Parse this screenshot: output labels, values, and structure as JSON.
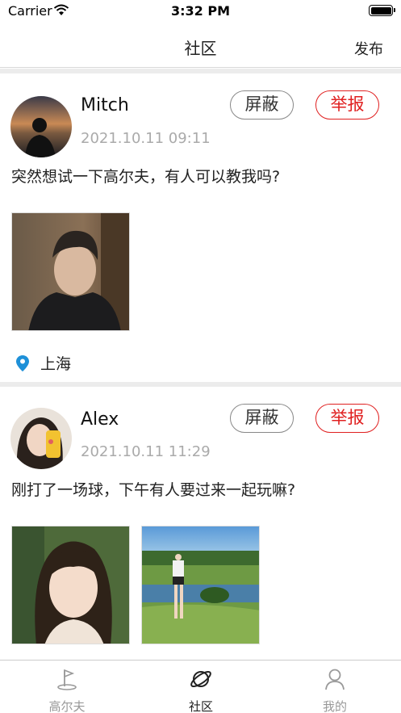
{
  "status_bar": {
    "carrier": "Carrier",
    "time": "3:32 PM"
  },
  "nav": {
    "title": "社区",
    "publish_label": "发布"
  },
  "posts": [
    {
      "username": "Mitch",
      "time": "2021.10.11 09:11",
      "block_label": "屏蔽",
      "report_label": "举报",
      "content": "突然想试一下高尔夫，有人可以教我吗?",
      "location": "上海"
    },
    {
      "username": "Alex",
      "time": "2021.10.11 11:29",
      "block_label": "屏蔽",
      "report_label": "举报",
      "content": "刚打了一场球，下午有人要过来一起玩嘛?"
    }
  ],
  "tabs": [
    {
      "label": "高尔夫",
      "icon": "golf-flag-icon",
      "active": false
    },
    {
      "label": "社区",
      "icon": "planet-icon",
      "active": true
    },
    {
      "label": "我的",
      "icon": "person-icon",
      "active": false
    }
  ],
  "colors": {
    "accent_red": "#e02020",
    "location_blue": "#1e90d8",
    "active_tab": "#222222",
    "inactive_tab": "#999999"
  }
}
